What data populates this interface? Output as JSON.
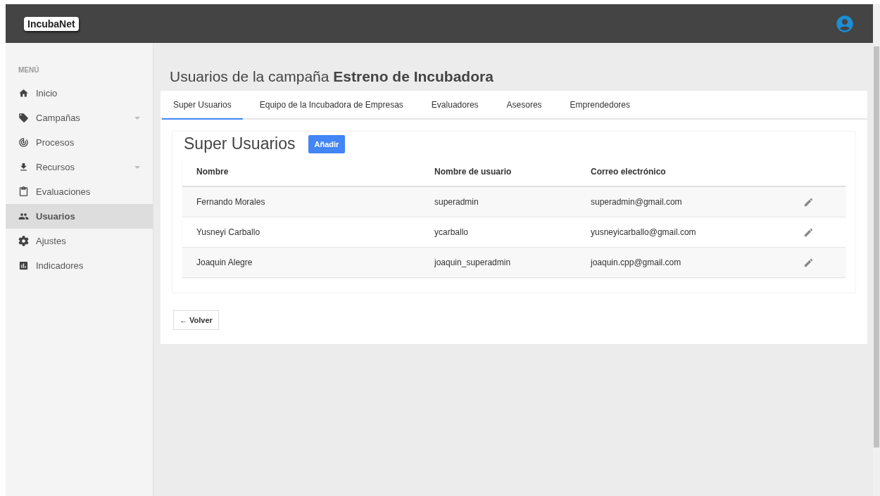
{
  "header": {
    "logo": "IncubaNet"
  },
  "sidebar": {
    "heading": "MENÚ",
    "items": [
      {
        "label": "Inicio",
        "submenu": false,
        "selected": false
      },
      {
        "label": "Campañas",
        "submenu": true,
        "selected": false
      },
      {
        "label": "Procesos",
        "submenu": false,
        "selected": false
      },
      {
        "label": "Recursos",
        "submenu": true,
        "selected": false
      },
      {
        "label": "Evaluaciones",
        "submenu": false,
        "selected": false
      },
      {
        "label": "Usuarios",
        "submenu": false,
        "selected": true
      },
      {
        "label": "Ajustes",
        "submenu": false,
        "selected": false
      },
      {
        "label": "Indicadores",
        "submenu": false,
        "selected": false
      }
    ]
  },
  "page_title": "Usuarios de la campaña **Estreno de Incubadora**",
  "tabs": [
    {
      "label": "Super Usuarios",
      "selected": true
    },
    {
      "label": "Equipo de la Incubadora de Empresas",
      "selected": false
    },
    {
      "label": "Evaluadores",
      "selected": false
    },
    {
      "label": "Asesores",
      "selected": false
    },
    {
      "label": "Emprendedores",
      "selected": false
    }
  ],
  "section": {
    "title": "Super Usuarios",
    "add_button": "Añadir"
  },
  "table": {
    "columns": [
      "Nombre",
      "Nombre de usuario",
      "Correo electrónico"
    ],
    "rows": [
      {
        "name": "Fernando Morales",
        "username": "superadmin",
        "email": "superadmin@gmail.com"
      },
      {
        "name": "Yusneyi Carballo",
        "username": "ycarballo",
        "email": "yusneyicarballo@gmail.com"
      },
      {
        "name": "Joaquin Alegre",
        "username": "joaquin_superadmin",
        "email": "joaquin.cpp@gmail.com"
      }
    ]
  },
  "back_button": "← Volver"
}
